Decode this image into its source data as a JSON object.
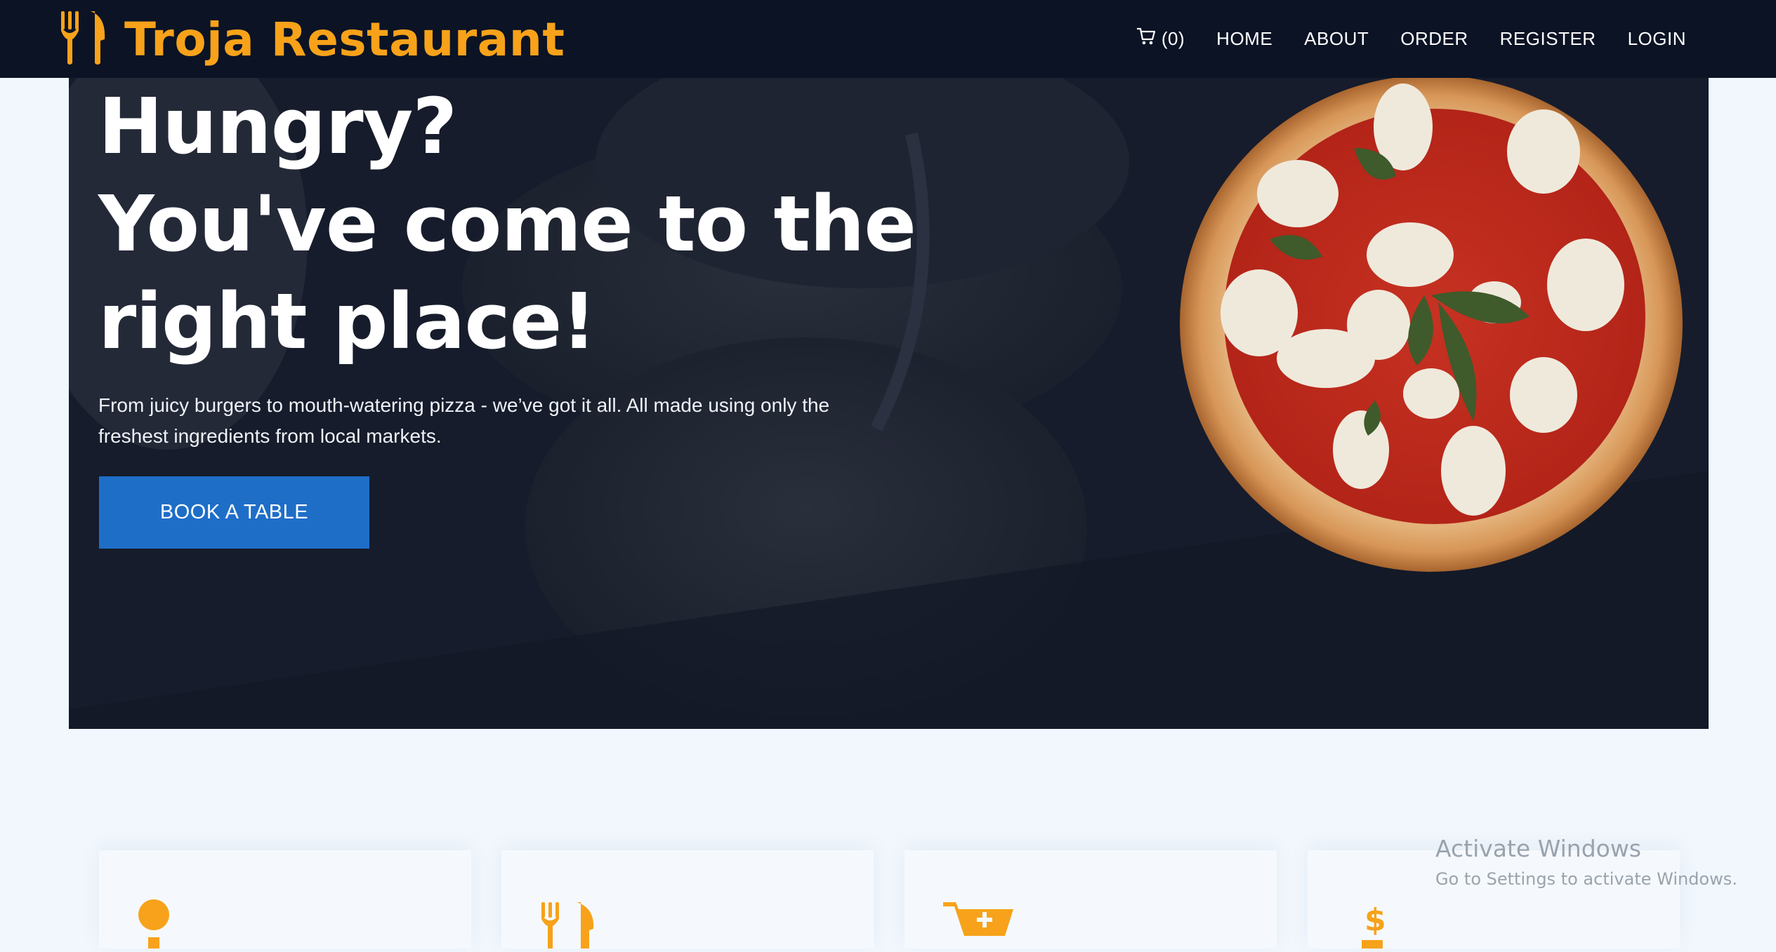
{
  "brand": {
    "name": "Troja Restaurant",
    "icon": "utensils-icon",
    "color": "#f7a21a"
  },
  "nav": {
    "cart_label": "(0)",
    "items": [
      "HOME",
      "ABOUT",
      "ORDER",
      "REGISTER",
      "LOGIN"
    ]
  },
  "hero": {
    "title_lines": [
      "Hungry?",
      "You've come to the",
      "right place!"
    ],
    "subtitle": "From juicy burgers to mouth-watering pizza - we’ve got it all. All made using only the freshest ingredients from local markets.",
    "button_label": "BOOK A TABLE",
    "button_color": "#1e6ec8"
  },
  "cards": [
    {
      "icon": "info-icon"
    },
    {
      "icon": "utensils-icon"
    },
    {
      "icon": "cart-plus-icon"
    },
    {
      "icon": "dollar-icon"
    }
  ],
  "watermark": {
    "title": "Activate Windows",
    "subtitle": "Go to Settings to activate Windows."
  }
}
